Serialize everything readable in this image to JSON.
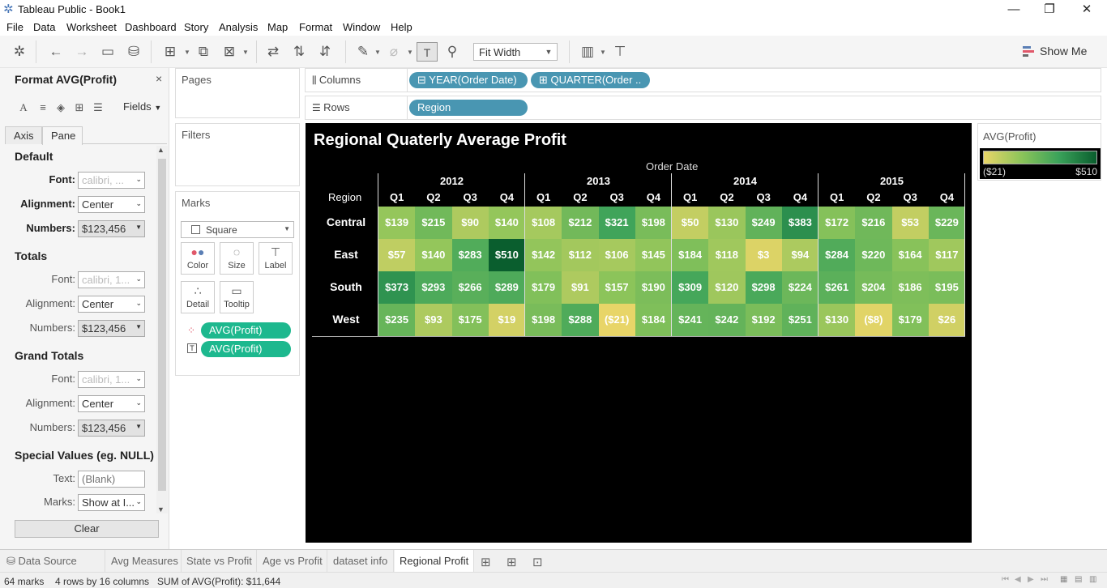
{
  "window": {
    "title": "Tableau Public - Book1",
    "minimize": "—",
    "restore": "❐",
    "close": "✕"
  },
  "menu": [
    "File",
    "Data",
    "Worksheet",
    "Dashboard",
    "Story",
    "Analysis",
    "Map",
    "Format",
    "Window",
    "Help"
  ],
  "toolbar": {
    "fit_width": "Fit Width",
    "show_me": "Show Me"
  },
  "format_panel": {
    "title": "Format AVG(Profit)",
    "close": "×",
    "fields": "Fields",
    "tabs": [
      "Axis",
      "Pane"
    ],
    "active_tab": "Pane",
    "sections": {
      "default": {
        "heading": "Default",
        "font_label": "Font:",
        "font_value": "calibri, ...",
        "alignment_label": "Alignment:",
        "alignment_value": "Center",
        "numbers_label": "Numbers:",
        "numbers_value": "$123,456"
      },
      "totals": {
        "heading": "Totals",
        "font_label": "Font:",
        "font_value": "calibri, 1...",
        "alignment_label": "Alignment:",
        "alignment_value": "Center",
        "numbers_label": "Numbers:",
        "numbers_value": "$123,456"
      },
      "grand_totals": {
        "heading": "Grand Totals",
        "font_label": "Font:",
        "font_value": "calibri, 1...",
        "alignment_label": "Alignment:",
        "alignment_value": "Center",
        "numbers_label": "Numbers:",
        "numbers_value": "$123,456"
      },
      "special": {
        "heading": "Special Values (eg. NULL)",
        "text_label": "Text:",
        "text_placeholder": "(Blank)",
        "marks_label": "Marks:",
        "marks_value": "Show at I..."
      }
    },
    "clear": "Clear"
  },
  "cards": {
    "pages": "Pages",
    "filters": "Filters",
    "marks": "Marks",
    "mark_type": "Square",
    "buttons": [
      "Color",
      "Size",
      "Label",
      "Detail",
      "Tooltip"
    ],
    "pills": [
      "AVG(Profit)",
      "AVG(Profit)"
    ]
  },
  "shelves": {
    "columns_label": "Columns",
    "rows_label": "Rows",
    "columns": [
      "YEAR(Order Date)",
      "QUARTER(Order .."
    ],
    "rows": [
      "Region"
    ]
  },
  "viz": {
    "title": "Regional Quaterly Average Profit",
    "column_header": "Order Date",
    "row_header": "Region"
  },
  "legend": {
    "title": "AVG(Profit)",
    "min": "($21)",
    "max": "$510",
    "colors": [
      "#e8d568",
      "#8cc45a",
      "#3aa25a",
      "#0a5e2e"
    ]
  },
  "chart_data": {
    "type": "heatmap",
    "title": "Regional Quaterly Average Profit",
    "xlabel": "Order Date",
    "ylabel": "Region",
    "years": [
      "2012",
      "2013",
      "2014",
      "2015"
    ],
    "quarters": [
      "Q1",
      "Q2",
      "Q3",
      "Q4"
    ],
    "rows": [
      {
        "name": "Central",
        "values": [
          139,
          215,
          90,
          140,
          108,
          212,
          321,
          198,
          50,
          130,
          249,
          383,
          172,
          216,
          53,
          229
        ],
        "labels": [
          "$139",
          "$215",
          "$90",
          "$140",
          "$108",
          "$212",
          "$321",
          "$198",
          "$50",
          "$130",
          "$249",
          "$383",
          "$172",
          "$216",
          "$53",
          "$229"
        ]
      },
      {
        "name": "East",
        "values": [
          57,
          140,
          283,
          510,
          142,
          112,
          106,
          145,
          184,
          118,
          3,
          94,
          284,
          220,
          164,
          117
        ],
        "labels": [
          "$57",
          "$140",
          "$283",
          "$510",
          "$142",
          "$112",
          "$106",
          "$145",
          "$184",
          "$118",
          "$3",
          "$94",
          "$284",
          "$220",
          "$164",
          "$117"
        ]
      },
      {
        "name": "South",
        "values": [
          373,
          293,
          266,
          289,
          179,
          91,
          157,
          190,
          309,
          120,
          298,
          224,
          261,
          204,
          186,
          195
        ],
        "labels": [
          "$373",
          "$293",
          "$266",
          "$289",
          "$179",
          "$91",
          "$157",
          "$190",
          "$309",
          "$120",
          "$298",
          "$224",
          "$261",
          "$204",
          "$186",
          "$195"
        ]
      },
      {
        "name": "West",
        "values": [
          235,
          93,
          175,
          19,
          198,
          288,
          -21,
          184,
          241,
          242,
          192,
          251,
          130,
          -8,
          179,
          26
        ],
        "labels": [
          "$235",
          "$93",
          "$175",
          "$19",
          "$198",
          "$288",
          "($21)",
          "$184",
          "$241",
          "$242",
          "$192",
          "$251",
          "$130",
          "($8)",
          "$179",
          "$26"
        ]
      }
    ],
    "color_range": [
      -21,
      510
    ]
  },
  "sheet_tabs": [
    "Data Source",
    "Avg Measures",
    "State vs Profit",
    "Age vs Profit",
    "dataset info",
    "Regional Profit"
  ],
  "active_sheet": "Regional Profit",
  "status": {
    "marks": "64 marks",
    "dims": "4 rows by 16 columns",
    "sum": "SUM of AVG(Profit): $11,644"
  }
}
